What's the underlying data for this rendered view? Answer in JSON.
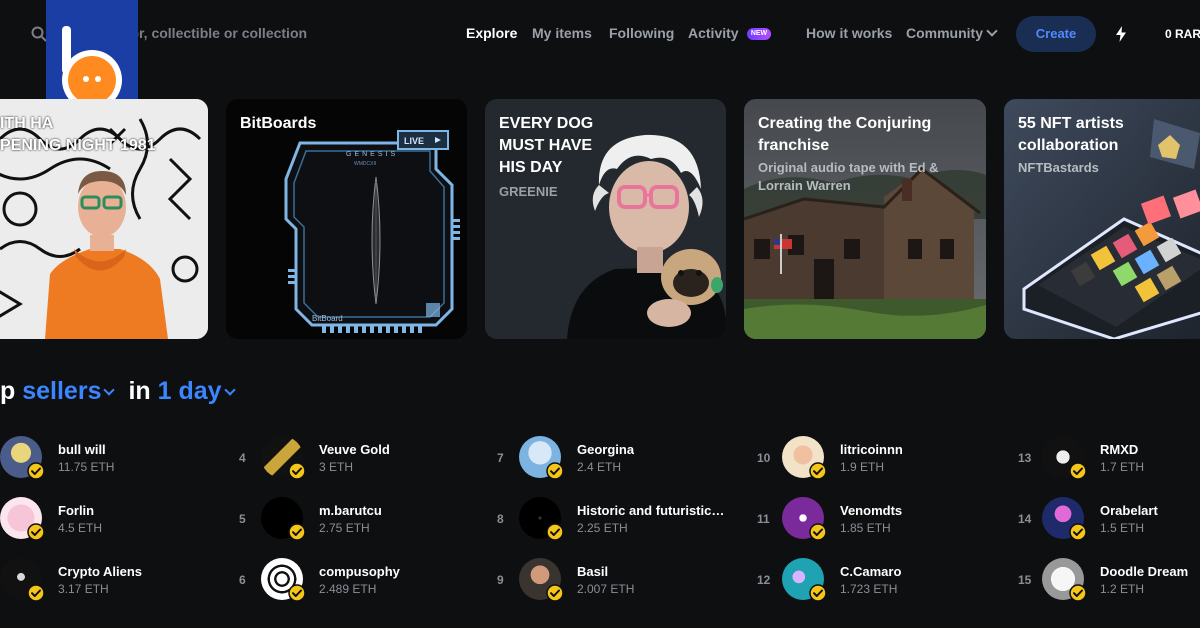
{
  "header": {
    "search_placeholder": "ator, collectible or collection",
    "nav": [
      "Explore",
      "My items",
      "Following",
      "Activity",
      "How it works",
      "Community"
    ],
    "new_badge": "NEW",
    "create_label": "Create",
    "balance": "0 RAR"
  },
  "cards": [
    {
      "title_lines": [
        "ITH HA",
        "PENING NIGHT 1981"
      ],
      "subtitle": ""
    },
    {
      "title_lines": [
        "BitBoards"
      ],
      "subtitle": "",
      "art": {
        "genesis": "GENESIS",
        "code": "WMDCXII",
        "live": "LIVE",
        "brand": "BitBoard"
      }
    },
    {
      "title_lines": [
        "EVERY DOG",
        "MUST HAVE",
        "HIS DAY"
      ],
      "subtitle": "GREENIE"
    },
    {
      "title_lines": [
        "Creating the Conjuring",
        "franchise"
      ],
      "subtitle_lines": [
        "Original audio tape with Ed &",
        "Lorrain Warren"
      ]
    },
    {
      "title_lines": [
        "55 NFT artists",
        "collaboration"
      ],
      "subtitle": "NFTBastards"
    }
  ],
  "sellers_heading": {
    "prefix": "p",
    "type": "sellers",
    "mid": "in",
    "period": "1 day"
  },
  "sellers": [
    {
      "rank": "",
      "name": "bull will",
      "eth": "11.75 ETH"
    },
    {
      "rank": "",
      "name": "Forlin",
      "eth": "4.5 ETH"
    },
    {
      "rank": "",
      "name": "Crypto Aliens",
      "eth": "3.17 ETH"
    },
    {
      "rank": "4",
      "name": "Veuve Gold",
      "eth": "3 ETH"
    },
    {
      "rank": "5",
      "name": "m.barutcu",
      "eth": "2.75 ETH"
    },
    {
      "rank": "6",
      "name": "compusophy",
      "eth": "2.489 ETH"
    },
    {
      "rank": "7",
      "name": "Georgina",
      "eth": "2.4 ETH"
    },
    {
      "rank": "8",
      "name": "Historic and futuristic collectibles",
      "eth": "2.25 ETH"
    },
    {
      "rank": "9",
      "name": "Basil",
      "eth": "2.007 ETH"
    },
    {
      "rank": "10",
      "name": "litricoinnn",
      "eth": "1.9 ETH"
    },
    {
      "rank": "11",
      "name": "Venomdts",
      "eth": "1.85 ETH"
    },
    {
      "rank": "12",
      "name": "C.Camaro",
      "eth": "1.723 ETH"
    },
    {
      "rank": "13",
      "name": "RMXD",
      "eth": "1.7 ETH"
    },
    {
      "rank": "14",
      "name": "Orabelart",
      "eth": "1.5 ETH"
    },
    {
      "rank": "15",
      "name": "Doodle Dream",
      "eth": "1.2 ETH"
    }
  ],
  "colors": {
    "accent": "#3b86ff",
    "logo_blue": "#1a3ea3",
    "logo_orange": "#ff8a1f",
    "verified": "#f5c518"
  }
}
